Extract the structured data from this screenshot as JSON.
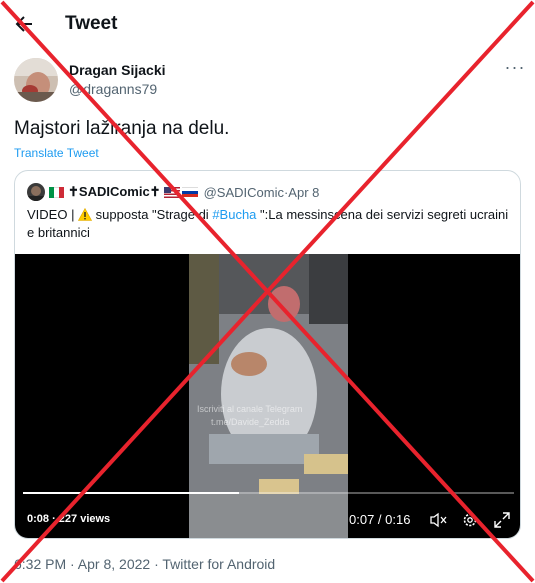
{
  "header": {
    "title": "Tweet"
  },
  "tweet": {
    "author_name": "Dragan Sijacki",
    "author_handle": "@draganns79",
    "text": "Majstori lažiranja na delu.",
    "translate_label": "Translate Tweet",
    "meta": "6:32 PM · Apr 8, 2022 · Twitter for Android"
  },
  "quote": {
    "author_name": "✝SADIComic✝",
    "author_handle": "@SADIComic",
    "separator": " · ",
    "date": "Apr 8",
    "text_prefix": "VIDEO | ",
    "text_middle": " supposta \"Strage di ",
    "hashtag": "#Bucha",
    "text_suffix": " \":La messinscena dei servizi segreti ucraini e britannici"
  },
  "video": {
    "views": "0:08 · 227 views",
    "time": "0:07 / 0:16",
    "progress": 0.44,
    "watermark": "Iscriviti al canale Telegram t.me/Davide_Zedda"
  },
  "colors": {
    "link": "#1d9bf0",
    "secondary_text": "#536471",
    "cross": "#e8232d"
  },
  "icons": {
    "back": "arrow-left-icon",
    "more": "more-horizontal-icon",
    "warning": "warning-icon",
    "mute": "volume-muted-icon",
    "settings": "gear-icon",
    "fullscreen": "fullscreen-icon"
  }
}
